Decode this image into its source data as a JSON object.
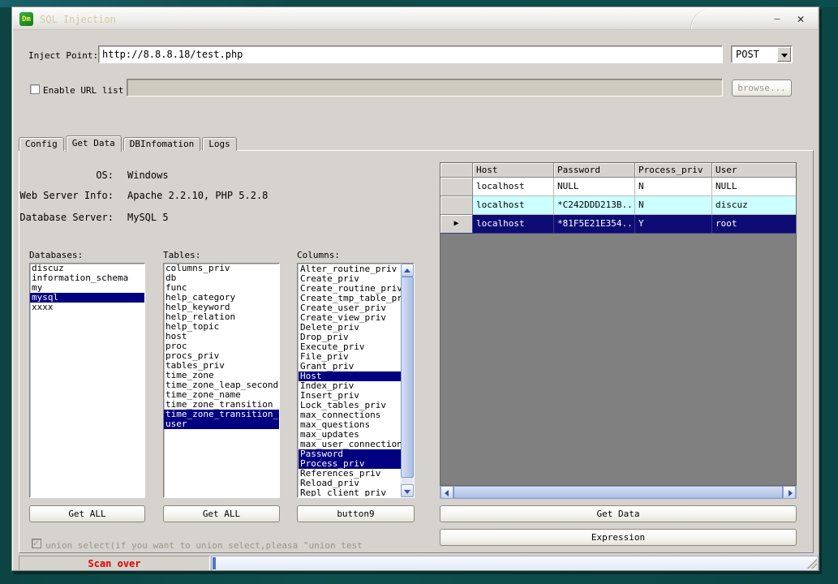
{
  "window": {
    "title": "SQL Injection",
    "icon_text": "Dm",
    "minimize_glyph": "—",
    "close_glyph": "✕"
  },
  "inject": {
    "label": "Inject Point:",
    "url": "http://8.8.8.18/test.php",
    "method": "POST"
  },
  "url_list": {
    "checkbox_label": "Enable URL list",
    "checked": false,
    "value": "",
    "browse_label": "browse..."
  },
  "tabs": [
    "Config",
    "Get Data",
    "DBInfomation",
    "Logs"
  ],
  "active_tab": "Get Data",
  "server_info": {
    "os_label": "OS:",
    "os": "Windows",
    "web_label": "Web Server Info:",
    "web": "Apache 2.2.10, PHP 5.2.8",
    "db_label": "Database Server:",
    "db": "MySQL 5"
  },
  "databases": {
    "label": "Databases:",
    "button": "Get ALL",
    "selected": [
      "mysql"
    ],
    "items": [
      "discuz",
      "information_schema",
      "my",
      "mysql",
      "xxxx"
    ]
  },
  "tables": {
    "label": "Tables:",
    "button": "Get ALL",
    "selected": [
      "time_zone_transition_ty",
      "user"
    ],
    "items": [
      "columns_priv",
      "db",
      "func",
      "help_category",
      "help_keyword",
      "help_relation",
      "help_topic",
      "host",
      "proc",
      "procs_priv",
      "tables_priv",
      "time_zone",
      "time_zone_leap_second",
      "time_zone_name",
      "time_zone_transition",
      "time_zone_transition_ty",
      "user"
    ]
  },
  "columns": {
    "label": "Columns:",
    "button": "button9",
    "selected": [
      "Host",
      "Password",
      "Process_priv"
    ],
    "items": [
      "Alter_routine_priv",
      "Create_priv",
      "Create_routine_priv",
      "Create_tmp_table_priv",
      "Create_user_priv",
      "Create_view_priv",
      "Delete_priv",
      "Drop_priv",
      "Execute_priv",
      "File_priv",
      "Grant_priv",
      "Host",
      "Index_priv",
      "Insert_priv",
      "Lock_tables_priv",
      "max_connections",
      "max_questions",
      "max_updates",
      "max_user_connections",
      "Password",
      "Process_priv",
      "References_priv",
      "Reload_priv",
      "Repl_client_priv"
    ]
  },
  "grid": {
    "headers": [
      "Host",
      "Password",
      "Process_priv",
      "User"
    ],
    "rows": [
      {
        "cells": [
          "localhost",
          "NULL",
          "N",
          "NULL"
        ],
        "style": "white",
        "current": false
      },
      {
        "cells": [
          "localhost",
          "*C242DDD213B...",
          "N",
          "discuz"
        ],
        "style": "cyan",
        "current": false
      },
      {
        "cells": [
          "localhost",
          "*81F5E21E354...",
          "Y",
          "root"
        ],
        "style": "selected",
        "current": true
      }
    ],
    "get_data_label": "Get Data",
    "expression_label": "Expression"
  },
  "union_option": {
    "label": "union select(if you want to union select,pleasa \"union test",
    "checked": true
  },
  "status": {
    "left": "Scan over"
  }
}
